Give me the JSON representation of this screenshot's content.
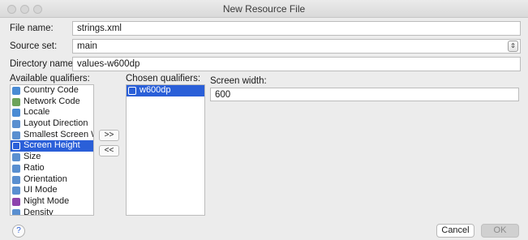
{
  "window": {
    "title": "New Resource File"
  },
  "form": {
    "file_name_label": "File name:",
    "file_name_value": "strings.xml",
    "source_set_label": "Source set:",
    "source_set_value": "main",
    "directory_name_label": "Directory name:",
    "directory_name_value": "values-w600dp"
  },
  "qualifiers": {
    "available_label": "Available qualifiers:",
    "chosen_label": "Chosen qualifiers:",
    "available": [
      {
        "label": "Country Code",
        "icon": "globe-icon",
        "color": "#4a8bd4"
      },
      {
        "label": "Network Code",
        "icon": "network-icon",
        "color": "#6ca35a"
      },
      {
        "label": "Locale",
        "icon": "locale-globe-icon",
        "color": "#4a8bd4"
      },
      {
        "label": "Layout Direction",
        "icon": "layout-direction-icon",
        "color": "#5a8fd0"
      },
      {
        "label": "Smallest Screen Wid",
        "icon": "smallest-screen-icon",
        "color": "#5a8fd0"
      },
      {
        "label": "Screen Height",
        "icon": "screen-height-icon",
        "color": "#ffffff"
      },
      {
        "label": "Size",
        "icon": "size-icon",
        "color": "#5a8fd0"
      },
      {
        "label": "Ratio",
        "icon": "ratio-icon",
        "color": "#5a8fd0"
      },
      {
        "label": "Orientation",
        "icon": "orientation-icon",
        "color": "#5a8fd0"
      },
      {
        "label": "UI Mode",
        "icon": "ui-mode-icon",
        "color": "#5a8fd0"
      },
      {
        "label": "Night Mode",
        "icon": "night-mode-icon",
        "color": "#8e44ad"
      },
      {
        "label": "Density",
        "icon": "density-icon",
        "color": "#5a8fd0"
      }
    ],
    "selected_available": "Screen Height",
    "chosen": [
      {
        "label": "w600dp",
        "icon": "screen-width-icon"
      }
    ],
    "add_button": ">>",
    "remove_button": "<<"
  },
  "detail": {
    "screen_width_label": "Screen width:",
    "screen_width_value": "600"
  },
  "buttons": {
    "help": "?",
    "cancel": "Cancel",
    "ok": "OK"
  },
  "colors": {
    "selection": "#2a5fd8"
  }
}
